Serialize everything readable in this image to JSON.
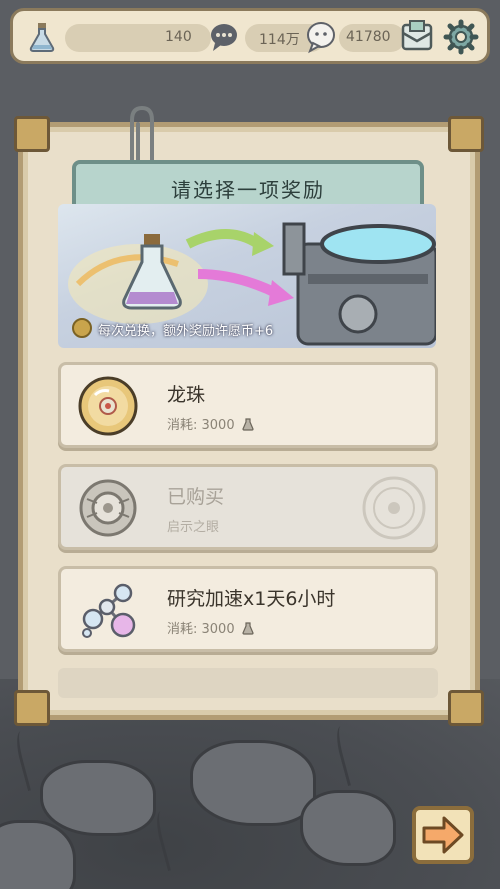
{
  "hud": {
    "potion_count": "140",
    "currency_1": "114万",
    "currency_2": "41780",
    "icons": [
      "potion-icon",
      "chat-icon",
      "wish-coin-icon",
      "mail-icon",
      "gear-icon"
    ]
  },
  "dialog": {
    "title": "请选择一项奖励",
    "hero_note": "每次兑换，额外奖励许愿币+6"
  },
  "rewards": [
    {
      "name": "龙珠",
      "sub": "消耗: 3000",
      "state": "available",
      "icon": "dragon-orb-icon"
    },
    {
      "name": "已购买",
      "sub": "启示之眼",
      "state": "purchased",
      "icon": "ring-icon"
    },
    {
      "name": "研究加速x1天6小时",
      "sub": "消耗: 3000",
      "state": "available",
      "icon": "molecule-icon"
    }
  ],
  "colors": {
    "panel": "#e9dfca",
    "banner": "#b7d4cc",
    "accent": "#c9a865"
  }
}
